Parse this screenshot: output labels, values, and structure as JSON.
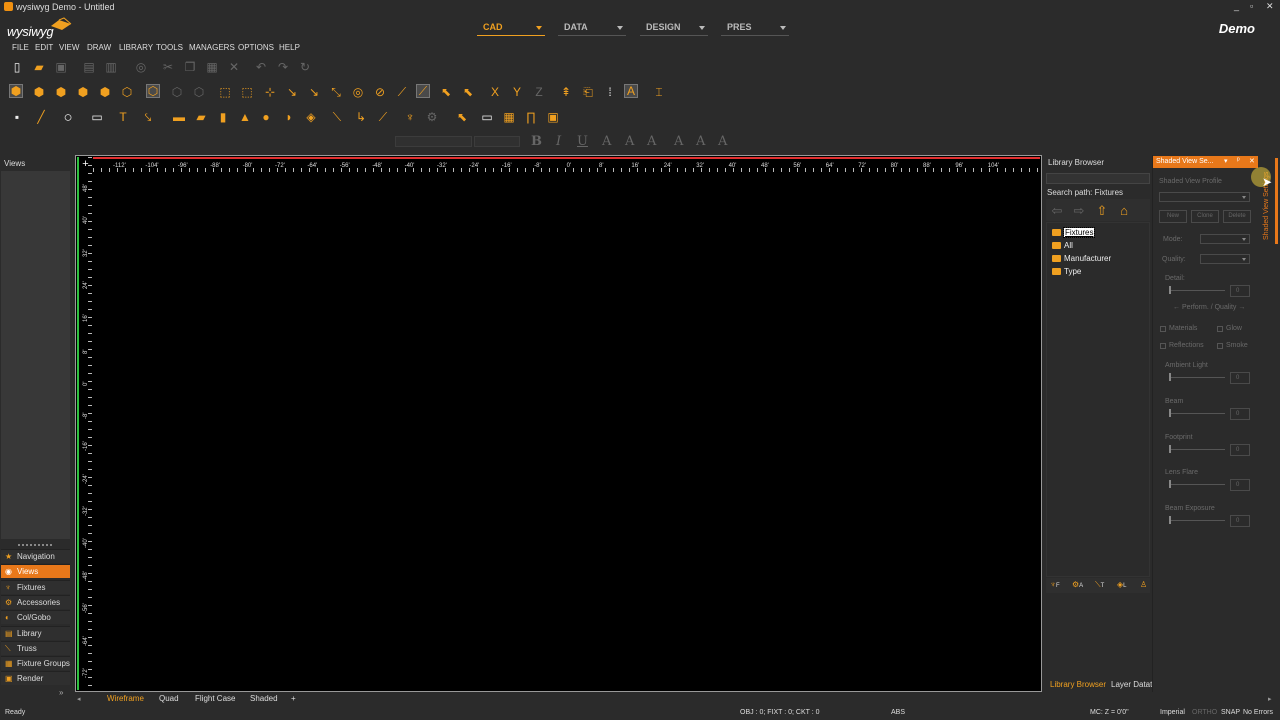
{
  "window": {
    "title": "wysiwyg Demo - Untitled",
    "controls": [
      "_",
      "▫",
      "✕"
    ]
  },
  "header": {
    "logo": "wysiwyg",
    "edition": "Demo",
    "modes": [
      {
        "label": "CAD",
        "active": true
      },
      {
        "label": "DATA",
        "active": false
      },
      {
        "label": "DESIGN",
        "active": false
      },
      {
        "label": "PRES",
        "active": false
      }
    ]
  },
  "menu": [
    "FILE",
    "EDIT",
    "VIEW",
    "DRAW",
    "LIBRARY",
    "TOOLS",
    "MANAGERS",
    "OPTIONS",
    "HELP"
  ],
  "toolbar_rows": {
    "row1": [
      "new-file",
      "open-folder",
      "save",
      "save-as",
      "print",
      "print-preview",
      "cut",
      "copy",
      "paste",
      "delete",
      "undo",
      "redo",
      "refresh"
    ],
    "row2": [
      "cube-front",
      "cube-side",
      "cube-top",
      "cube-iso",
      "cube-shaded",
      "cube-open",
      "wire-cube",
      "wire-cube-2",
      "wire-cube-3",
      "select-box",
      "select-box-2",
      "node-edit",
      "move",
      "line-tool",
      "scale",
      "snap",
      "ruler",
      "measure",
      "hatch",
      "pointer",
      "multi-select",
      "x-axis",
      "y-axis",
      "z-axis",
      "lift",
      "rotate",
      "grid",
      "text-tool",
      "dimension"
    ],
    "row3": [
      "point",
      "line",
      "circle",
      "rectangle",
      "text",
      "insert",
      "pipe",
      "tube",
      "cylinder",
      "cone",
      "sphere",
      "shield",
      "eraser",
      "lamp",
      "arc",
      "ruler-2",
      "truss",
      "bolt",
      "light-tool",
      "screen",
      "pattern",
      "arch",
      "camera"
    ]
  },
  "format_bar": {
    "buttons": [
      "B",
      "I",
      "U",
      "A",
      "A",
      "A",
      "A",
      "A",
      "A"
    ]
  },
  "left_panel": {
    "title": "Views",
    "items": [
      {
        "label": "Navigation",
        "icon": "star-icon",
        "active": false
      },
      {
        "label": "Views",
        "icon": "eye-icon",
        "active": true
      },
      {
        "label": "Fixtures",
        "icon": "fixture-icon",
        "active": false
      },
      {
        "label": "Accessories",
        "icon": "accessory-icon",
        "active": false
      },
      {
        "label": "Col/Gobo",
        "icon": "gobo-icon",
        "active": false
      },
      {
        "label": "Library",
        "icon": "book-icon",
        "active": false
      },
      {
        "label": "Truss",
        "icon": "truss-icon",
        "active": false
      },
      {
        "label": "Fixture Groups",
        "icon": "group-icon",
        "active": false
      },
      {
        "label": "Render",
        "icon": "render-icon",
        "active": false
      }
    ]
  },
  "viewport": {
    "h_ruler": [
      "-112'",
      "-104'",
      "-96'",
      "-88'",
      "-80'",
      "-72'",
      "-64'",
      "-56'",
      "-48'",
      "-40'",
      "-32'",
      "-24'",
      "-16'",
      "-8'",
      "0'",
      "8'",
      "16'",
      "24'",
      "32'",
      "40'",
      "48'",
      "56'",
      "64'",
      "72'",
      "80'",
      "88'",
      "96'",
      "104'"
    ],
    "v_ruler": [
      "48'",
      "40'",
      "32'",
      "24'",
      "16'",
      "8'",
      "0'",
      "-8'",
      "-16'",
      "-24'",
      "-32'",
      "-40'",
      "-48'",
      "-56'",
      "-64'",
      "-72'"
    ],
    "tabs": [
      {
        "label": "Wireframe",
        "active": true
      },
      {
        "label": "Quad",
        "active": false
      },
      {
        "label": "Flight Case",
        "active": false
      },
      {
        "label": "Shaded",
        "active": false
      },
      {
        "label": "+",
        "active": false
      }
    ]
  },
  "library_browser": {
    "title": "Library Browser",
    "search_path": "Search path: Fixtures",
    "tree": [
      {
        "label": "Fixtures",
        "selected": true
      },
      {
        "label": "All",
        "selected": false
      },
      {
        "label": "Manufacturer",
        "selected": false
      },
      {
        "label": "Type",
        "selected": false
      }
    ],
    "filter_icons": [
      "F",
      "A",
      "T",
      "L"
    ],
    "tabs": [
      {
        "label": "Library Browser",
        "active": true
      },
      {
        "label": "Layer Datat",
        "active": false
      }
    ]
  },
  "shaded_view": {
    "title": "Shaded View Se...",
    "profile_label": "Shaded View Profile",
    "buttons": [
      "New",
      "Clone",
      "Delete"
    ],
    "mode_label": "Mode:",
    "quality_label": "Quality:",
    "detail_label": "Detail:",
    "perf_label": "← Perform. / Quality →",
    "checks": [
      "Materials",
      "Glow",
      "Reflections",
      "Smoke"
    ],
    "sliders": [
      {
        "label": "Ambient Light",
        "value": "0"
      },
      {
        "label": "Beam",
        "value": "0"
      },
      {
        "label": "Footprint",
        "value": "0"
      },
      {
        "label": "Lens Flare",
        "value": "0"
      },
      {
        "label": "Beam Exposure",
        "value": "0"
      }
    ],
    "detail_value": "0",
    "side_label": "Shaded View Settings"
  },
  "status": {
    "ready": "Ready",
    "counts": "OBJ : 0; FIXT : 0; CKT : 0",
    "abs": "ABS",
    "mc": "MC: Z = 0'0\"",
    "units": "Imperial",
    "ortho": "ORTHO",
    "snap": "SNAP",
    "errors": "No Errors"
  }
}
